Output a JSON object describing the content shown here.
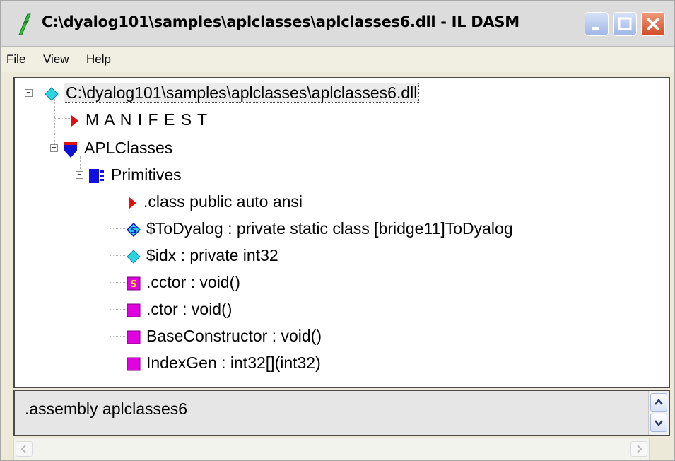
{
  "window": {
    "title": "C:\\dyalog101\\samples\\aplclasses\\aplclasses6.dll - IL DASM"
  },
  "menu": {
    "items": [
      {
        "label": "File"
      },
      {
        "label": "View"
      },
      {
        "label": "Help"
      }
    ]
  },
  "tree": {
    "nodes": [
      {
        "label": "C:\\dyalog101\\samples\\aplclasses\\aplclasses6.dll",
        "icon": "assembly-diamond-icon"
      },
      {
        "label": "M A N I F E S T",
        "icon": "red-triangle-icon"
      },
      {
        "label": "APLClasses",
        "icon": "namespace-shield-icon"
      },
      {
        "label": "Primitives",
        "icon": "class-icon"
      },
      {
        "label": ".class public auto ansi",
        "icon": "red-triangle-icon"
      },
      {
        "label": "$ToDyalog : private static class [bridge11]ToDyalog",
        "icon": "static-field-icon"
      },
      {
        "label": "$idx : private int32",
        "icon": "field-diamond-icon"
      },
      {
        "label": ".cctor : void()",
        "icon": "static-method-icon"
      },
      {
        "label": ".ctor : void()",
        "icon": "method-icon"
      },
      {
        "label": "BaseConstructor : void()",
        "icon": "method-icon"
      },
      {
        "label": "IndexGen : int32[](int32)",
        "icon": "method-icon"
      }
    ]
  },
  "detail": {
    "text": ".assembly aplclasses6"
  },
  "colors": {
    "selection_outline": "#444444",
    "method": "#e000e0",
    "field": "#00c8d8",
    "namespace": "#1010d0",
    "manifest": "#e01010"
  }
}
